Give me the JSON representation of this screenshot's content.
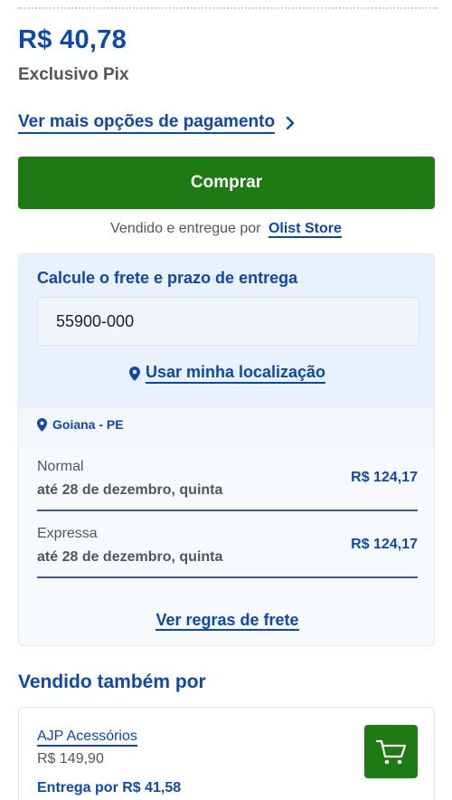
{
  "price": {
    "value": "R$ 40,78",
    "label": "Exclusivo Pix"
  },
  "payment": {
    "more_options_label": "Ver mais opções de pagamento"
  },
  "buy_button": {
    "label": "Comprar",
    "color": "#1e7a12"
  },
  "sold_by": {
    "prefix": "Vendido e entregue por",
    "store": "Olist Store"
  },
  "shipping": {
    "title": "Calcule o frete e prazo de entrega",
    "cep_value": "55900-000",
    "use_location_label": "Usar minha localização",
    "city": "Goiana - PE",
    "options": [
      {
        "name": "Normal",
        "eta": "até 28 de dezembro, quinta",
        "price": "R$ 124,17"
      },
      {
        "name": "Expressa",
        "eta": "até 28 de dezembro, quinta",
        "price": "R$ 124,17"
      }
    ],
    "rules_label": "Ver regras de frete"
  },
  "also_sold_by": {
    "title": "Vendido também por",
    "sellers": [
      {
        "name": "AJP Acessórios",
        "price": "R$ 149,90",
        "shipping": "Entrega por R$ 41,58"
      }
    ]
  },
  "colors": {
    "brand_blue": "#0c47b2",
    "action_green": "#1e7a12"
  },
  "icons": {
    "chevron": "chevron-right-icon",
    "location": "map-pin-icon",
    "cart": "shopping-cart-icon"
  }
}
